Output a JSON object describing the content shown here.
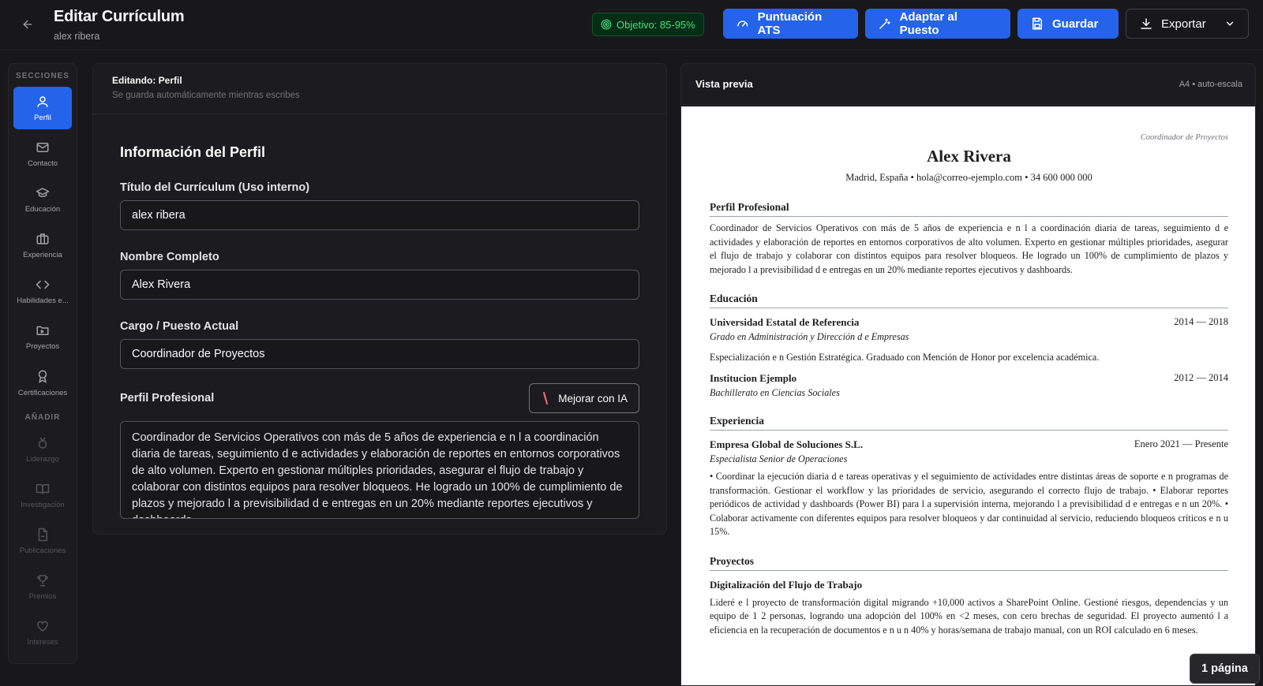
{
  "header": {
    "title": "Editar Currículum",
    "subtitle": "alex ribera",
    "target_badge": "Objetivo: 85-95%",
    "ats_label": "Puntuación ATS",
    "adapt_label": "Adaptar al Puesto",
    "save_label": "Guardar",
    "export_label": "Exportar"
  },
  "sidebar": {
    "sections_heading": "SECCIONES",
    "items": [
      {
        "label": "Perfil",
        "icon": "user-icon"
      },
      {
        "label": "Contacto",
        "icon": "mail-icon"
      },
      {
        "label": "Educación",
        "icon": "graduation-cap-icon"
      },
      {
        "label": "Experiencia",
        "icon": "briefcase-icon"
      },
      {
        "label": "Habilidades e...",
        "icon": "code-icon"
      },
      {
        "label": "Proyectos",
        "icon": "folder-icon"
      },
      {
        "label": "Certificaciones",
        "icon": "award-icon"
      }
    ],
    "add_heading": "AÑADIR",
    "add_items": [
      {
        "label": "Liderazgo",
        "icon": "medal-icon"
      },
      {
        "label": "Investigación",
        "icon": "book-icon"
      },
      {
        "label": "Publicaciones",
        "icon": "file-icon"
      },
      {
        "label": "Premios",
        "icon": "trophy-icon"
      },
      {
        "label": "Intereses",
        "icon": "heart-icon"
      }
    ]
  },
  "editor": {
    "editing_label": "Editando: Perfil",
    "editing_sub": "Se guarda automáticamente mientras escribes",
    "section_title": "Información del Perfil",
    "resume_title_label": "Título del Currículum (Uso interno)",
    "resume_title_value": "alex ribera",
    "full_name_label": "Nombre Completo",
    "full_name_value": "Alex Rivera",
    "position_label": "Cargo / Puesto Actual",
    "position_value": "Coordinador de Proyectos",
    "profile_label": "Perfil Profesional",
    "ai_button": "Mejorar con IA",
    "profile_value": "Coordinador de Servicios Operativos con más de 5 años de experiencia e n l a coordinación diaria de tareas, seguimiento d e actividades y elaboración de reportes en entornos corporativos de alto volumen. Experto en gestionar múltiples prioridades, asegurar el flujo de trabajo y colaborar con distintos equipos para resolver bloqueos. He logrado un 100% de cumplimiento de plazos y mejorado l a previsibilidad d e entregas en un 20% mediante reportes ejecutivos y dashboards."
  },
  "preview": {
    "title": "Vista previa",
    "meta": "A4 • auto-escala",
    "page_count": "1 página",
    "doc": {
      "role_top": "Coordinador de Proyectos",
      "name": "Alex Rivera",
      "contact": "Madrid, España • hola@correo-ejemplo.com • 34 600 000 000",
      "profile_heading": "Perfil Profesional",
      "profile_text": "Coordinador de Servicios Operativos con más de 5 años de experiencia e n l a coordinación diaria de tareas, seguimiento d e actividades y elaboración de reportes en entornos corporativos de alto volumen. Experto en gestionar múltiples prioridades, asegurar el flujo de trabajo y colaborar con distintos equipos para resolver bloqueos. He logrado un 100% de cumplimiento de plazos y mejorado l a previsibilidad d e entregas en un 20% mediante reportes ejecutivos y dashboards.",
      "education_heading": "Educación",
      "edu1_school": "Universidad Estatal de Referencia",
      "edu1_dates": "2014 — 2018",
      "edu1_degree": "Grado en Administración y Dirección d e Empresas",
      "edu1_note": "Especialización e n Gestión Estratégica. Graduado con Mención de Honor por excelencia académica.",
      "edu2_school": "Institucion Ejemplo",
      "edu2_dates": "2012 — 2014",
      "edu2_degree": "Bachillerato en Ciencias Sociales",
      "experience_heading": "Experiencia",
      "exp1_company": "Empresa Global de Soluciones S.L.",
      "exp1_dates": "Enero 2021 — Presente",
      "exp1_role": "Especialista Senior de Operaciones",
      "exp1_text": "• Coordinar la ejecución diaria d e tareas operativas y el seguimiento de actividades entre distintas áreas de soporte e n programas de transformación. Gestionar el workflow y las prioridades de servicio, asegurando el correcto flujo de trabajo. • Elaborar reportes periódicos de actividad y dashboards (Power BI) para l a supervisión interna, mejorando l a previsibilidad d e entregas e n un 20%. • Colaborar activamente con diferentes equipos para resolver bloqueos y dar continuidad al servicio, reduciendo bloqueos críticos e n u 15%.",
      "projects_heading": "Proyectos",
      "proj1_name": "Digitalización del Flujo de Trabajo",
      "proj1_text": "Lideré e l proyecto de transformación digital migrando +10,000 activos a SharePoint Online. Gestioné riesgos, dependencias y un equipo de 1 2 personas, logrando una adopción del 100% en <2 meses, con cero brechas de seguridad. El proyecto aumentó l a eficiencia en la recuperación de documentos e n u n 40% y horas/semana de trabajo manual, con un ROI calculado en 6 meses."
    }
  }
}
